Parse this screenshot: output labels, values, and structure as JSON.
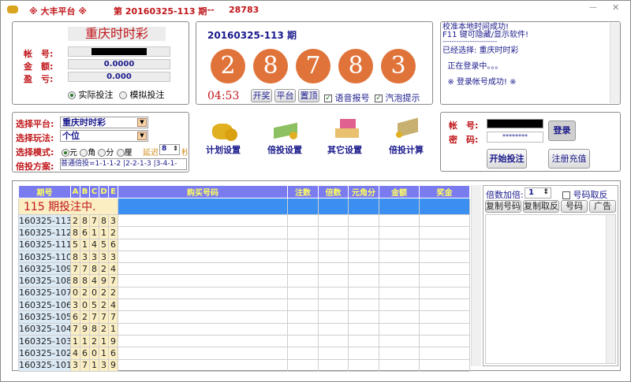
{
  "titlebar": {
    "logo_icon": "coin-icon",
    "app_name": "※ 大丰平台 ※",
    "issue_text": "第 20160325-113 期",
    "separator": "---",
    "number": "28783",
    "minimize": "—",
    "close": "✕"
  },
  "account_panel": {
    "lottery": "重庆时时彩",
    "account_label": "帐　号:",
    "balance_label": "金　额:",
    "profit_label": "盈　亏:",
    "balance": "0.0000",
    "profit": "0.000",
    "mode_real": "实际投注",
    "mode_sim": "模拟投注",
    "selected_mode": "real"
  },
  "draw_panel": {
    "issue": "20160325-113 期",
    "balls": [
      "2",
      "8",
      "7",
      "8",
      "3"
    ],
    "countdown": "04:53",
    "btn_draw": "开奖",
    "btn_platform": "平台",
    "btn_top": "置顶",
    "voice_label": "语音报号",
    "voice_checked": true,
    "bubble_label": "汽泡提示",
    "bubble_checked": true,
    "ball_color": "#e0733a"
  },
  "log_panel": {
    "lines": [
      "校准本地时间成功!",
      "F11 键可隐藏/显示软件!",
      "------------------------",
      "已经选择: 重庆时时彩",
      "  正在登录中。。。",
      "  ※ 登录帐号成功! ※"
    ]
  },
  "settings_panel": {
    "platform_label": "选择平台:",
    "platform_value": "重庆时时彩",
    "play_label": "选择玩法:",
    "play_value": "个位",
    "mode_label": "选择模式:",
    "modes": [
      "元",
      "角",
      "分",
      "厘"
    ],
    "selected_mode": "元",
    "delay_label": "延迟",
    "delay_value": "8",
    "delay_unit": "秒",
    "plan_label": "倍投方案:",
    "plan_value": "普通倍投=1-1-1-2 |2-2-1-3 |3-4-1-"
  },
  "tools": [
    {
      "label": "计划设置",
      "icon": "coins-stack-icon"
    },
    {
      "label": "倍投设置",
      "icon": "money-bills-icon"
    },
    {
      "label": "其它设置",
      "icon": "house-money-icon"
    },
    {
      "label": "倍投计算",
      "icon": "money-calc-icon"
    }
  ],
  "login_panel": {
    "account_label": "帐　号:",
    "password_label": "密　码:",
    "password_value": "********",
    "login_btn": "登录",
    "start_btn": "开始投注",
    "register_btn": "注册充值"
  },
  "table": {
    "headers": [
      "期号",
      "A",
      "B",
      "C",
      "D",
      "E",
      "购买号码",
      "注数",
      "倍数",
      "元角分",
      "金额",
      "奖金"
    ],
    "current": "115 期投注中.",
    "rows": [
      [
        "160325-113",
        "2",
        "8",
        "7",
        "8",
        "3"
      ],
      [
        "160325-112",
        "8",
        "6",
        "1",
        "1",
        "2"
      ],
      [
        "160325-111",
        "5",
        "1",
        "4",
        "5",
        "6"
      ],
      [
        "160325-110",
        "8",
        "3",
        "3",
        "3",
        "3"
      ],
      [
        "160325-109",
        "7",
        "7",
        "8",
        "2",
        "4"
      ],
      [
        "160325-108",
        "8",
        "8",
        "4",
        "9",
        "7"
      ],
      [
        "160325-107",
        "0",
        "2",
        "0",
        "2",
        "2"
      ],
      [
        "160325-106",
        "3",
        "0",
        "5",
        "2",
        "4"
      ],
      [
        "160325-105",
        "6",
        "2",
        "7",
        "7",
        "7"
      ],
      [
        "160325-104",
        "7",
        "9",
        "8",
        "2",
        "1"
      ],
      [
        "160325-103",
        "1",
        "1",
        "2",
        "1",
        "9"
      ],
      [
        "160325-102",
        "4",
        "6",
        "0",
        "1",
        "6"
      ],
      [
        "160325-101",
        "3",
        "7",
        "1",
        "3",
        "9"
      ]
    ]
  },
  "right_panel": {
    "multiplier_label": "倍数加倍:",
    "multiplier_value": "1",
    "invert_label": "号码取反",
    "invert_checked": false,
    "btn_copy": "复制号码",
    "btn_copy_invert": "复制取反",
    "btn_numbers": "号码",
    "btn_ads": "广告"
  }
}
